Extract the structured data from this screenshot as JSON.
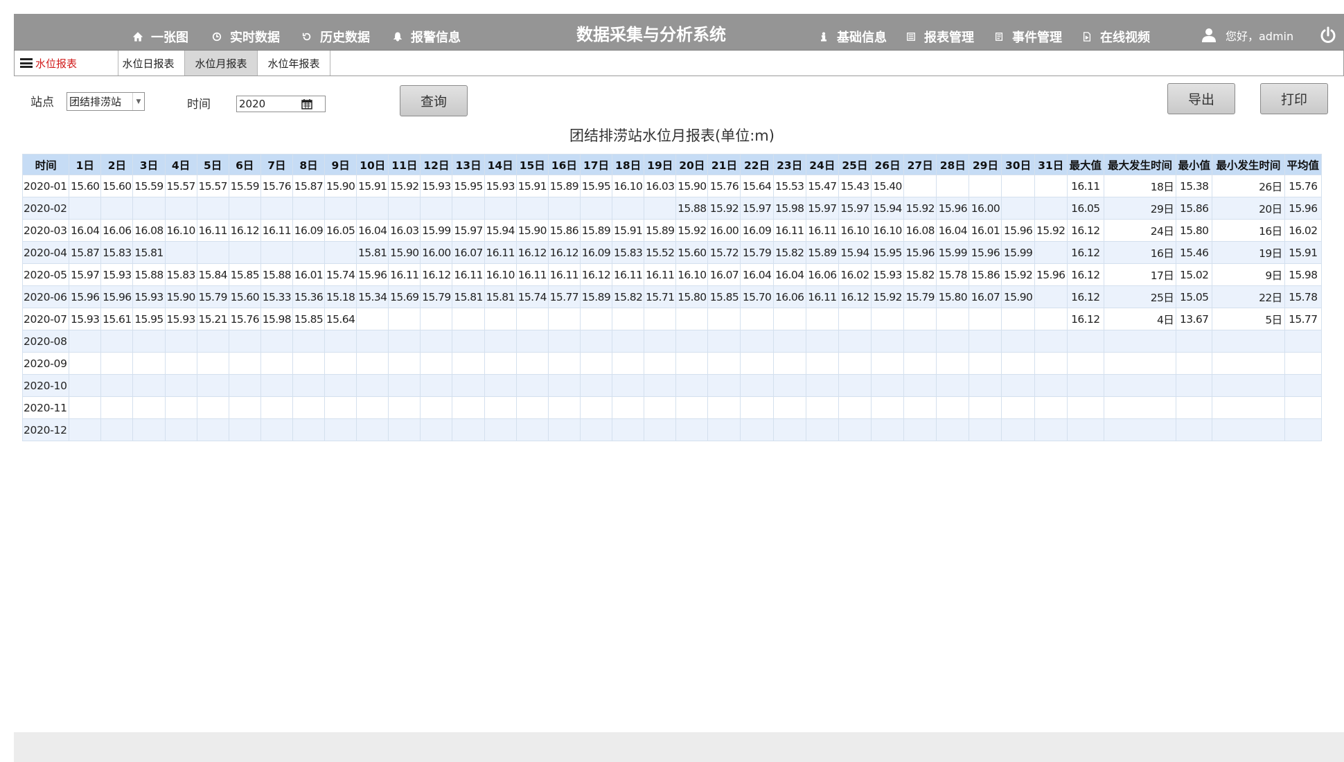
{
  "nav": {
    "left_items": [
      {
        "label": "一张图",
        "icon": "home-icon"
      },
      {
        "label": "实时数据",
        "icon": "clock-icon"
      },
      {
        "label": "历史数据",
        "icon": "history-icon"
      },
      {
        "label": "报警信息",
        "icon": "bell-icon"
      }
    ],
    "title": "数据采集与分析系统",
    "right_items": [
      {
        "label": "基础信息",
        "icon": "info-icon"
      },
      {
        "label": "报表管理",
        "icon": "list-icon"
      },
      {
        "label": "事件管理",
        "icon": "doc-icon"
      },
      {
        "label": "在线视频",
        "icon": "video-file-icon"
      }
    ],
    "user_greeting": "您好，admin"
  },
  "tabs": {
    "menu_label": "水位报表",
    "items": [
      "水位日报表",
      "水位月报表",
      "水位年报表"
    ],
    "active_index": 1
  },
  "filter": {
    "station_label": "站点",
    "station_value": "团结排涝站",
    "time_label": "时间",
    "time_value": "2020",
    "query_button": "查询",
    "export_button": "导出",
    "print_button": "打印"
  },
  "report": {
    "title": "团结排涝站水位月报表(单位:m)",
    "columns": [
      "时间",
      "1日",
      "2日",
      "3日",
      "4日",
      "5日",
      "6日",
      "7日",
      "8日",
      "9日",
      "10日",
      "11日",
      "12日",
      "13日",
      "14日",
      "15日",
      "16日",
      "17日",
      "18日",
      "19日",
      "20日",
      "21日",
      "22日",
      "23日",
      "24日",
      "25日",
      "26日",
      "27日",
      "28日",
      "29日",
      "30日",
      "31日",
      "最大值",
      "最大发生时间",
      "最小值",
      "最小发生时间",
      "平均值"
    ],
    "rows": [
      [
        "2020-01",
        "15.60",
        "15.60",
        "15.59",
        "15.57",
        "15.57",
        "15.59",
        "15.76",
        "15.87",
        "15.90",
        "15.91",
        "15.92",
        "15.93",
        "15.95",
        "15.93",
        "15.91",
        "15.89",
        "15.95",
        "16.10",
        "16.03",
        "15.90",
        "15.76",
        "15.64",
        "15.53",
        "15.47",
        "15.43",
        "15.40",
        "",
        "",
        "",
        "",
        "",
        "16.11",
        "18日",
        "15.38",
        "26日",
        "15.76"
      ],
      [
        "2020-02",
        "",
        "",
        "",
        "",
        "",
        "",
        "",
        "",
        "",
        "",
        "",
        "",
        "",
        "",
        "",
        "",
        "",
        "",
        "",
        "15.88",
        "15.92",
        "15.97",
        "15.98",
        "15.97",
        "15.97",
        "15.94",
        "15.92",
        "15.96",
        "16.00",
        "",
        "",
        "16.05",
        "29日",
        "15.86",
        "20日",
        "15.96"
      ],
      [
        "2020-03",
        "16.04",
        "16.06",
        "16.08",
        "16.10",
        "16.11",
        "16.12",
        "16.11",
        "16.09",
        "16.05",
        "16.04",
        "16.03",
        "15.99",
        "15.97",
        "15.94",
        "15.90",
        "15.86",
        "15.89",
        "15.91",
        "15.89",
        "15.92",
        "16.00",
        "16.09",
        "16.11",
        "16.11",
        "16.10",
        "16.10",
        "16.08",
        "16.04",
        "16.01",
        "15.96",
        "15.92",
        "16.12",
        "24日",
        "15.80",
        "16日",
        "16.02"
      ],
      [
        "2020-04",
        "15.87",
        "15.83",
        "15.81",
        "",
        "",
        "",
        "",
        "",
        "",
        "15.81",
        "15.90",
        "16.00",
        "16.07",
        "16.11",
        "16.12",
        "16.12",
        "16.09",
        "15.83",
        "15.52",
        "15.60",
        "15.72",
        "15.79",
        "15.82",
        "15.89",
        "15.94",
        "15.95",
        "15.96",
        "15.99",
        "15.96",
        "15.99",
        "",
        "16.12",
        "16日",
        "15.46",
        "19日",
        "15.91"
      ],
      [
        "2020-05",
        "15.97",
        "15.93",
        "15.88",
        "15.83",
        "15.84",
        "15.85",
        "15.88",
        "16.01",
        "15.74",
        "15.96",
        "16.11",
        "16.12",
        "16.11",
        "16.10",
        "16.11",
        "16.11",
        "16.12",
        "16.11",
        "16.11",
        "16.10",
        "16.07",
        "16.04",
        "16.04",
        "16.06",
        "16.02",
        "15.93",
        "15.82",
        "15.78",
        "15.86",
        "15.92",
        "15.96",
        "16.12",
        "17日",
        "15.02",
        "9日",
        "15.98"
      ],
      [
        "2020-06",
        "15.96",
        "15.96",
        "15.93",
        "15.90",
        "15.79",
        "15.60",
        "15.33",
        "15.36",
        "15.18",
        "15.34",
        "15.69",
        "15.79",
        "15.81",
        "15.81",
        "15.74",
        "15.77",
        "15.89",
        "15.82",
        "15.71",
        "15.80",
        "15.85",
        "15.70",
        "16.06",
        "16.11",
        "16.12",
        "15.92",
        "15.79",
        "15.80",
        "16.07",
        "15.90",
        "",
        "16.12",
        "25日",
        "15.05",
        "22日",
        "15.78"
      ],
      [
        "2020-07",
        "15.93",
        "15.61",
        "15.95",
        "15.93",
        "15.21",
        "15.76",
        "15.98",
        "15.85",
        "15.64",
        "",
        "",
        "",
        "",
        "",
        "",
        "",
        "",
        "",
        "",
        "",
        "",
        "",
        "",
        "",
        "",
        "",
        "",
        "",
        "",
        "",
        "",
        "16.12",
        "4日",
        "13.67",
        "5日",
        "15.77"
      ],
      [
        "2020-08",
        "",
        "",
        "",
        "",
        "",
        "",
        "",
        "",
        "",
        "",
        "",
        "",
        "",
        "",
        "",
        "",
        "",
        "",
        "",
        "",
        "",
        "",
        "",
        "",
        "",
        "",
        "",
        "",
        "",
        "",
        "",
        "",
        "",
        "",
        "",
        ""
      ],
      [
        "2020-09",
        "",
        "",
        "",
        "",
        "",
        "",
        "",
        "",
        "",
        "",
        "",
        "",
        "",
        "",
        "",
        "",
        "",
        "",
        "",
        "",
        "",
        "",
        "",
        "",
        "",
        "",
        "",
        "",
        "",
        "",
        "",
        "",
        "",
        "",
        "",
        ""
      ],
      [
        "2020-10",
        "",
        "",
        "",
        "",
        "",
        "",
        "",
        "",
        "",
        "",
        "",
        "",
        "",
        "",
        "",
        "",
        "",
        "",
        "",
        "",
        "",
        "",
        "",
        "",
        "",
        "",
        "",
        "",
        "",
        "",
        "",
        "",
        "",
        "",
        "",
        ""
      ],
      [
        "2020-11",
        "",
        "",
        "",
        "",
        "",
        "",
        "",
        "",
        "",
        "",
        "",
        "",
        "",
        "",
        "",
        "",
        "",
        "",
        "",
        "",
        "",
        "",
        "",
        "",
        "",
        "",
        "",
        "",
        "",
        "",
        "",
        "",
        "",
        "",
        "",
        ""
      ],
      [
        "2020-12",
        "",
        "",
        "",
        "",
        "",
        "",
        "",
        "",
        "",
        "",
        "",
        "",
        "",
        "",
        "",
        "",
        "",
        "",
        "",
        "",
        "",
        "",
        "",
        "",
        "",
        "",
        "",
        "",
        "",
        "",
        "",
        "",
        "",
        "",
        "",
        ""
      ]
    ]
  },
  "colors": {
    "topbar": "#959595",
    "header_row": "#c6dcf5",
    "alt_row": "#ebf2fc",
    "menu_accent": "#d11a1a"
  }
}
